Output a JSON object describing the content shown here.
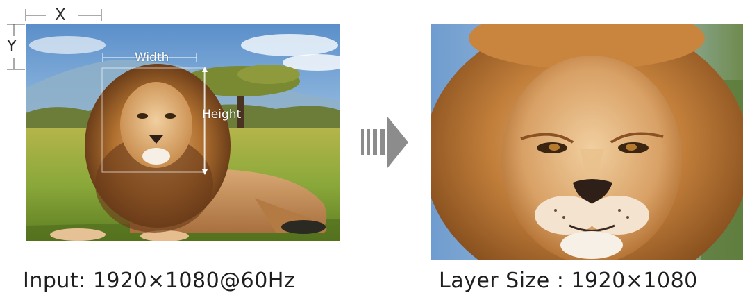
{
  "annotations": {
    "x": "X",
    "y": "Y",
    "width": "Width",
    "height": "Height"
  },
  "captions": {
    "input": "Input:  1920×1080@60Hz",
    "layer": "Layer Size : 1920×1080"
  },
  "colors": {
    "arrow": "#8c8c8c",
    "text": "#1e1e1e",
    "sky": "#7fb0de",
    "grass": "#8aa83a",
    "mane": "#a8652c"
  },
  "icons": {
    "transform-arrow": "striped-right-arrow"
  }
}
